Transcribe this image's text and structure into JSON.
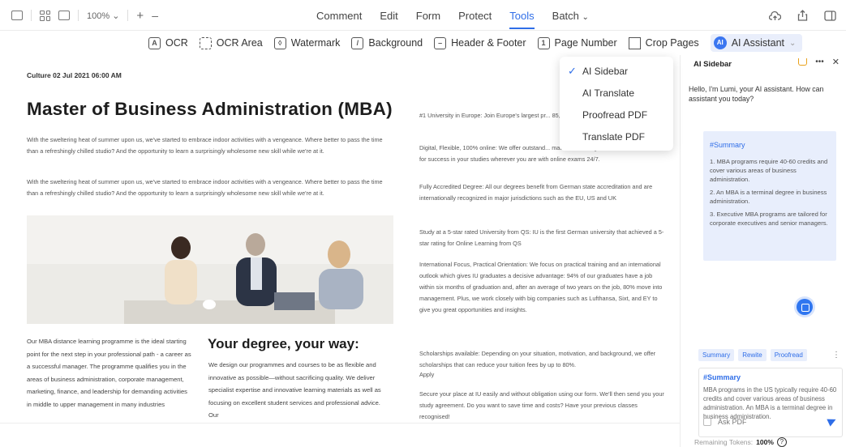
{
  "toolbar": {
    "zoom": "100%",
    "zoom_in": "+",
    "zoom_out": "–",
    "menu": [
      "Comment",
      "Edit",
      "Form",
      "Protect",
      "Tools",
      "Batch"
    ],
    "active_menu": "Tools"
  },
  "ribbon": {
    "ocr": "OCR",
    "ocr_area": "OCR Area",
    "watermark": "Watermark",
    "background": "Background",
    "header_footer": "Header & Footer",
    "page_number": "Page Number",
    "crop_pages": "Crop Pages",
    "ai_assistant": "AI Assistant",
    "ai_badge": "AI"
  },
  "dropdown": {
    "items": [
      "AI Sidebar",
      "AI Translate",
      "Proofread PDF",
      "Translate PDF"
    ],
    "checked": "AI Sidebar"
  },
  "document": {
    "meta": "Culture 02 Jul 2021 06:00 AM",
    "title": "Master of Business Administration (MBA)",
    "para1": "With the sweltering heat of summer upon us, we've started to embrace indoor activities with a vengeance. Where better to pass the time than a refreshingly chilled studio? And the opportunity to learn a surprisingly wholesome new skill while we're at it.",
    "para2": "With the sweltering heat of summer upon us, we've started to embrace indoor activities with a vengeance. Where better to pass the time than a refreshingly chilled studio? And the opportunity to learn a surprisingly wholesome new skill while we're at it.",
    "col1_bottom": "Our MBA distance learning programme is the ideal starting point for the next step in your professional path - a career as a successful manager. The programme qualifies you in the areas of business administration, corporate management, marketing, finance, and leadership for demanding activities in middle to upper management in many industries",
    "col2_title": "Your degree, your way:",
    "col2_text": "We design our programmes and courses to be as flexible and innovative as possible—without sacrificing quality. We deliver specialist expertise and innovative learning materials as well as focusing on excellent student services and professional advice. Our",
    "right_col": [
      "#1 University in Europe: Join Europe's largest pr... 85,000 students",
      "Digital, Flexible, 100% online: We offer outstand... materials and a great online environment for success in your studies wherever you are with online exams 24/7.",
      "Fully Accredited Degree: All our degrees benefit from German state accreditation and are internationally recognized in major jurisdictions such as the EU, US and UK",
      "Study at a 5-star rated University from QS: IU is the first German university that achieved a 5-star rating for Online Learning from QS",
      "International Focus, Practical Orientation: We focus on practical training and an international outlook which gives IU graduates a decisive advantage: 94% of our graduates have a job within six months of graduation and, after an average of two years on the job, 80% move into management. Plus, we work closely with big companies such as Lufthansa, Sixt, and EY to give you great opportunities and insights.",
      "Scholarships available: Depending on your situation, motivation, and background, we offer scholarships that can reduce your tuition fees by up to 80%.",
      "Apply",
      "Secure your place at IU easily and without obligation using our form. We'll then send you your study agreement. Do you want to save time and costs? Have your previous classes recognised!"
    ]
  },
  "sidebar": {
    "title": "AI Sidebar",
    "more": "•••",
    "close": "✕",
    "greeting": "Hello, I'm Lumi, your AI assistant. How can assistant you today?",
    "summary_heading": "#Summary",
    "summary_points": [
      "1. MBA programs require 40-60 credits and cover various areas of business administration.",
      "2. An MBA is a terminal degree in business administration.",
      "3. Executive MBA programs are tailored for corporate executives and senior managers."
    ],
    "chips": [
      "Summary",
      "Rewite",
      "Proofread"
    ],
    "chip_more": "⋮",
    "compose_heading": "#Summary",
    "compose_text": "MBA programs in the US typically require 40-60 credits and cover various areas of business administration. An MBA is a terminal degree in business administration.",
    "ask_pdf": "Ask PDF",
    "tokens_label": "Remaining Tokens:",
    "tokens_value": "100%",
    "help": "?"
  },
  "colors": {
    "accent": "#2f6ee8",
    "summary_bg": "#e8eefc",
    "cart": "#e9a21c"
  }
}
